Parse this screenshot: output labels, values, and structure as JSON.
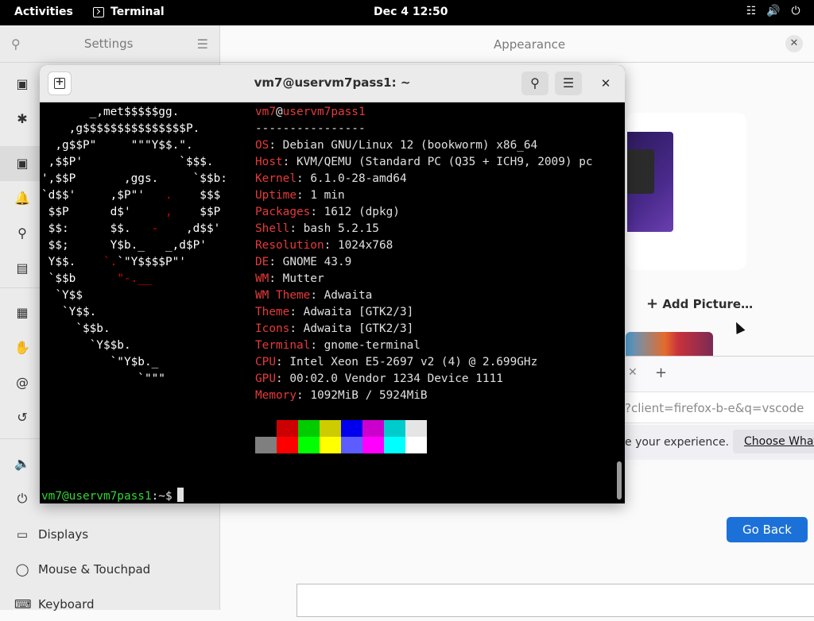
{
  "topbar": {
    "activities": "Activities",
    "app_name": "Terminal",
    "clock": "Dec 4  12:50",
    "tray_icons": [
      "network-icon",
      "volume-icon",
      "power-icon"
    ]
  },
  "settings": {
    "sidebar_title": "Settings",
    "panel_title": "Appearance",
    "sidebar_items": [
      {
        "label": "Displays",
        "icon": "display-icon"
      },
      {
        "label": "Mouse & Touchpad",
        "icon": "mouse-icon"
      },
      {
        "label": "Keyboard",
        "icon": "keyboard-icon"
      }
    ],
    "add_picture": "Add Picture…",
    "go_back": "Go Back"
  },
  "firefox": {
    "url": "?client=firefox-b-e&q=vscode",
    "notification": "e your experience.",
    "choose_button": "Choose What"
  },
  "terminal": {
    "title": "vm7@uservm7pass1: ~",
    "user": "vm7",
    "host": "uservm7pass1",
    "separator": "----------------",
    "info": [
      {
        "key": "OS",
        "value": "Debian GNU/Linux 12 (bookworm) x86_64"
      },
      {
        "key": "Host",
        "value": "KVM/QEMU (Standard PC (Q35 + ICH9, 2009) pc"
      },
      {
        "key": "Kernel",
        "value": "6.1.0-28-amd64"
      },
      {
        "key": "Uptime",
        "value": "1 min"
      },
      {
        "key": "Packages",
        "value": "1612 (dpkg)"
      },
      {
        "key": "Shell",
        "value": "bash 5.2.15"
      },
      {
        "key": "Resolution",
        "value": "1024x768"
      },
      {
        "key": "DE",
        "value": "GNOME 43.9"
      },
      {
        "key": "WM",
        "value": "Mutter"
      },
      {
        "key": "WM Theme",
        "value": "Adwaita"
      },
      {
        "key": "Theme",
        "value": "Adwaita [GTK2/3]"
      },
      {
        "key": "Icons",
        "value": "Adwaita [GTK2/3]"
      },
      {
        "key": "Terminal",
        "value": "gnome-terminal"
      },
      {
        "key": "CPU",
        "value": "Intel Xeon E5-2697 v2 (4) @ 2.699GHz"
      },
      {
        "key": "GPU",
        "value": "00:02.0 Vendor 1234 Device 1111"
      },
      {
        "key": "Memory",
        "value": "1092MiB / 5924MiB"
      }
    ],
    "palette_top": [
      "#000000",
      "#cc0000",
      "#00cc00",
      "#cccc00",
      "#0000ee",
      "#cc00cc",
      "#00cccc",
      "#e5e5e5"
    ],
    "palette_bottom": [
      "#7f7f7f",
      "#ff0000",
      "#00ff00",
      "#ffff00",
      "#5c5cff",
      "#ff00ff",
      "#00ffff",
      "#ffffff"
    ],
    "prompt_user_host": "vm7@uservm7pass1",
    "prompt_suffix": ":~$"
  },
  "colors": {
    "accent": "#1c71d8",
    "debian_red": "#e63a3a",
    "prompt_green": "#33d633"
  }
}
